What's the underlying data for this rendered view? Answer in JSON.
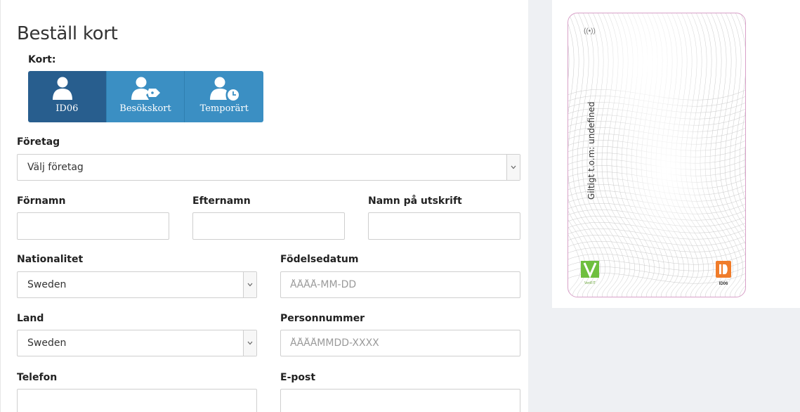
{
  "page": {
    "title": "Beställ kort"
  },
  "card_type": {
    "label": "Kort:",
    "options": [
      {
        "label": "ID06",
        "icon": "user-icon",
        "active": true
      },
      {
        "label": "Besökskort",
        "icon": "user-tag-icon",
        "active": false
      },
      {
        "label": "Temporärt",
        "icon": "user-clock-icon",
        "active": false
      }
    ]
  },
  "form": {
    "company": {
      "label": "Företag",
      "value": "Välj företag"
    },
    "first_name": {
      "label": "Förnamn",
      "value": ""
    },
    "last_name": {
      "label": "Efternamn",
      "value": ""
    },
    "print_name": {
      "label": "Namn på utskrift",
      "value": ""
    },
    "nationality": {
      "label": "Nationalitet",
      "value": "Sweden"
    },
    "birth_date": {
      "label": "Födelsedatum",
      "placeholder": "ÅÅÅÅ-MM-DD"
    },
    "country": {
      "label": "Land",
      "value": "Sweden"
    },
    "personal_number": {
      "label": "Personnummer",
      "placeholder": "ÅÅÅÅMMDD-XXXX"
    },
    "phone": {
      "label": "Telefon",
      "value": ""
    },
    "email": {
      "label": "E-post",
      "value": ""
    }
  },
  "card_preview": {
    "validity_text": "Giltigt t.o.m: undefined",
    "nfc_symbol": "((•))",
    "left_logo_text": "VeriFIT",
    "right_logo_text": "ID06"
  },
  "colors": {
    "button_active": "#285e8e",
    "button": "#3b8fc3",
    "card_border": "#d8a0c8"
  }
}
